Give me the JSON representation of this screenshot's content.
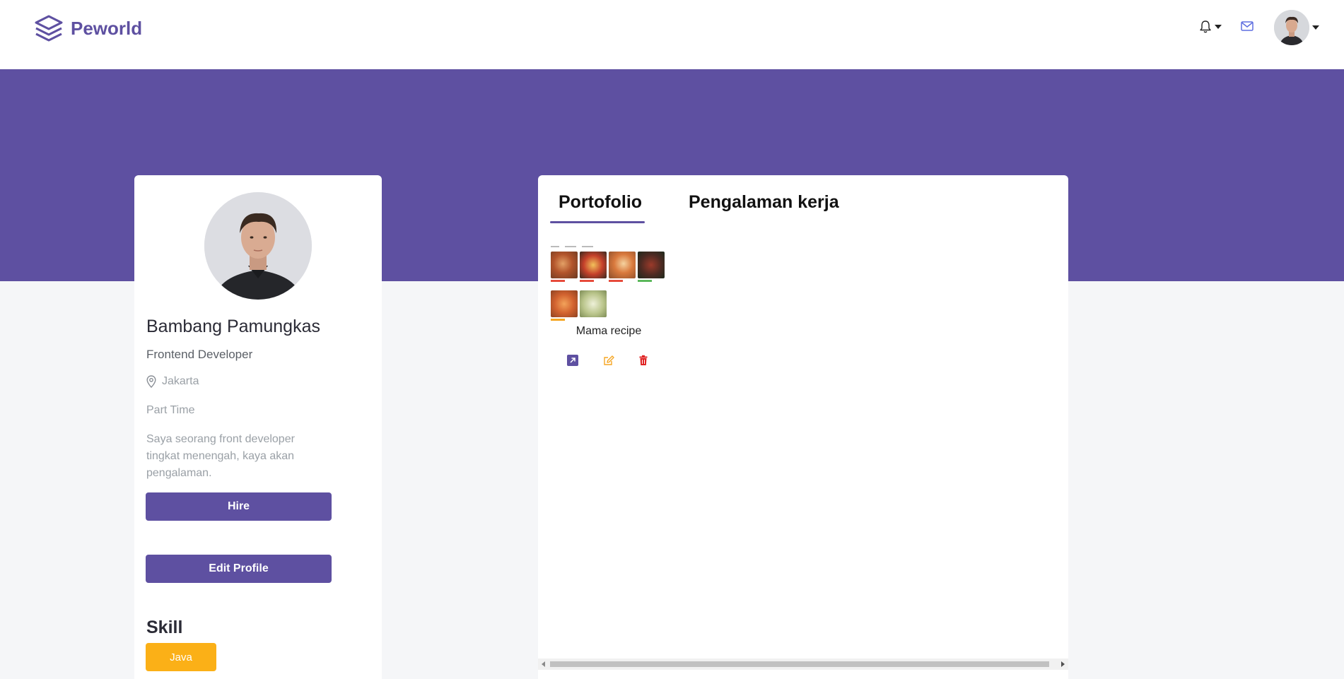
{
  "navbar": {
    "brand": "Peworld",
    "icons": {
      "logo": "layers-icon",
      "notification": "bell-icon",
      "mail": "mail-icon",
      "avatar": "avatar"
    },
    "colors": {
      "brand": "#5e50a1",
      "mail": "#5e6ee0"
    }
  },
  "profile": {
    "name": "Bambang Pamungkas",
    "role": "Frontend Developer",
    "location": "Jakarta",
    "job_type": "Part Time",
    "description": "Saya seorang front developer tingkat menengah, kaya akan pengalaman.",
    "hire_label": "Hire",
    "edit_label": "Edit Profile",
    "skill_title": "Skill",
    "skills": [
      "Java"
    ]
  },
  "tabs": [
    {
      "label": "Portofolio",
      "active": true
    },
    {
      "label": "Pengalaman kerja",
      "active": false
    }
  ],
  "portfolio": [
    {
      "title": "Mama recipe",
      "actions": [
        "open-link-icon",
        "edit-icon",
        "trash-icon"
      ]
    }
  ],
  "colors": {
    "primary": "#5e50a1",
    "skill_badge": "#fbb017",
    "page_bg": "#f5f6f8",
    "edit_icon": "#f5a623",
    "delete_icon": "#e02424"
  }
}
